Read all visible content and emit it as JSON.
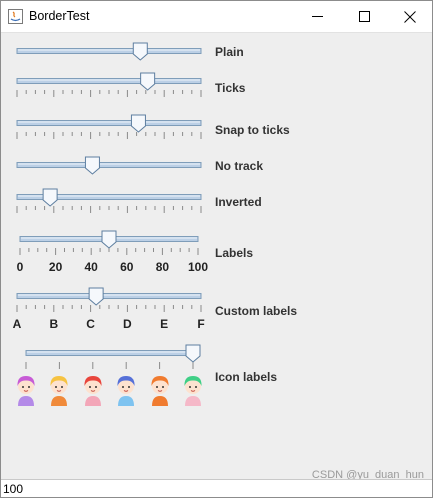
{
  "window": {
    "title": "BorderTest",
    "colors": {
      "track": "#bcd0e6",
      "track_border": "#7f9db9",
      "thumb": "#f5f8fc",
      "thumb_border": "#5d7ea0"
    }
  },
  "sliders": [
    {
      "label": "Plain",
      "min": 0,
      "max": 100,
      "value": 67
    },
    {
      "label": "Ticks",
      "min": 0,
      "max": 100,
      "value": 71
    },
    {
      "label": "Snap to ticks",
      "min": 0,
      "max": 100,
      "value": 66
    },
    {
      "label": "No track",
      "min": 0,
      "max": 100,
      "value": 41
    },
    {
      "label": "Inverted",
      "min": 0,
      "max": 100,
      "value": 82
    },
    {
      "label": "Labels",
      "min": 0,
      "max": 100,
      "value": 50,
      "tick_labels": [
        "0",
        "20",
        "40",
        "60",
        "80",
        "100"
      ]
    },
    {
      "label": "Custom labels",
      "min": 0,
      "max": 100,
      "value": 43,
      "tick_labels": [
        "A",
        "B",
        "C",
        "D",
        "E",
        "F"
      ]
    },
    {
      "label": "Icon labels",
      "min": 0,
      "max": 100,
      "value": 100,
      "icons": [
        "purple",
        "yellow",
        "red",
        "blue",
        "orange",
        "green"
      ]
    }
  ],
  "status": {
    "value": "100"
  },
  "watermark": "CSDN @yu_duan_hun"
}
